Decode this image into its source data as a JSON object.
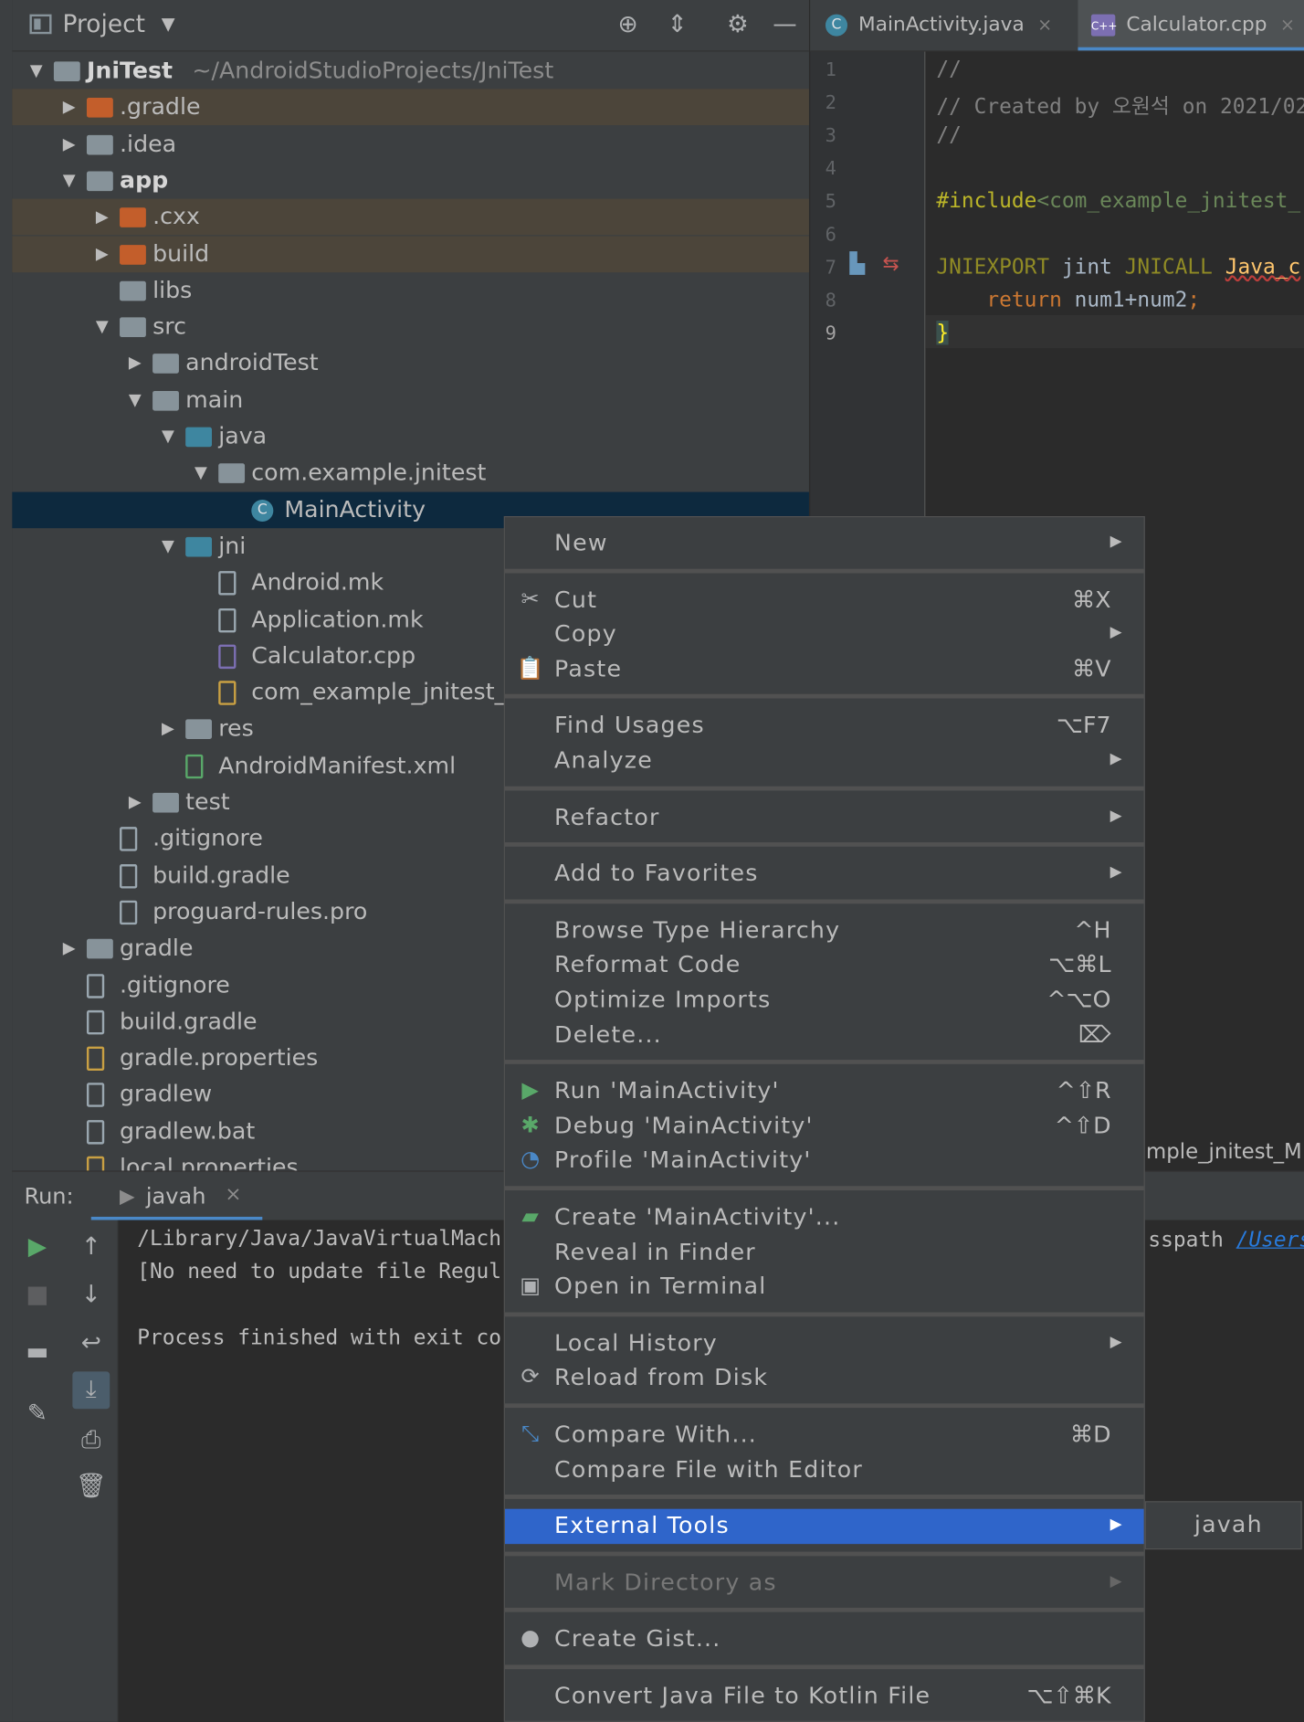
{
  "project_panel": {
    "title": "Project",
    "tree": [
      {
        "label": "JniTest",
        "hint": "~/AndroidStudioProjects/JniTest",
        "depth": 0,
        "arrow": "▼",
        "icon": "module-folder-icon",
        "bold": true
      },
      {
        "label": ".gradle",
        "depth": 1,
        "arrow": "▶",
        "icon": "folder-excluded-icon",
        "excluded": true
      },
      {
        "label": ".idea",
        "depth": 1,
        "arrow": "▶",
        "icon": "folder-icon"
      },
      {
        "label": "app",
        "depth": 1,
        "arrow": "▼",
        "icon": "module-folder-icon",
        "bold": true
      },
      {
        "label": ".cxx",
        "depth": 2,
        "arrow": "▶",
        "icon": "folder-excluded-icon",
        "excluded": true
      },
      {
        "label": "build",
        "depth": 2,
        "arrow": "▶",
        "icon": "folder-excluded-icon",
        "excluded": true
      },
      {
        "label": "libs",
        "depth": 2,
        "arrow": "",
        "icon": "folder-icon"
      },
      {
        "label": "src",
        "depth": 2,
        "arrow": "▼",
        "icon": "folder-icon"
      },
      {
        "label": "androidTest",
        "depth": 3,
        "arrow": "▶",
        "icon": "folder-icon"
      },
      {
        "label": "main",
        "depth": 3,
        "arrow": "▼",
        "icon": "folder-icon"
      },
      {
        "label": "java",
        "depth": 4,
        "arrow": "▼",
        "icon": "source-folder-icon"
      },
      {
        "label": "com.example.jnitest",
        "depth": 5,
        "arrow": "▼",
        "icon": "package-icon"
      },
      {
        "label": "MainActivity",
        "depth": 6,
        "arrow": "",
        "icon": "class-icon",
        "selected": true
      },
      {
        "label": "jni",
        "depth": 4,
        "arrow": "▼",
        "icon": "source-folder-icon"
      },
      {
        "label": "Android.mk",
        "depth": 5,
        "arrow": "",
        "icon": "file-icon"
      },
      {
        "label": "Application.mk",
        "depth": 5,
        "arrow": "",
        "icon": "file-icon"
      },
      {
        "label": "Calculator.cpp",
        "depth": 5,
        "arrow": "",
        "icon": "cpp-file-icon"
      },
      {
        "label": "com_example_jnitest_",
        "depth": 5,
        "arrow": "",
        "icon": "header-file-icon"
      },
      {
        "label": "res",
        "depth": 4,
        "arrow": "▶",
        "icon": "resources-folder-icon"
      },
      {
        "label": "AndroidManifest.xml",
        "depth": 4,
        "arrow": "",
        "icon": "manifest-file-icon"
      },
      {
        "label": "test",
        "depth": 3,
        "arrow": "▶",
        "icon": "folder-icon"
      },
      {
        "label": ".gitignore",
        "depth": 2,
        "arrow": "",
        "icon": "gitignore-icon"
      },
      {
        "label": "build.gradle",
        "depth": 2,
        "arrow": "",
        "icon": "gradle-elephant-icon"
      },
      {
        "label": "proguard-rules.pro",
        "depth": 2,
        "arrow": "",
        "icon": "file-icon"
      },
      {
        "label": "gradle",
        "depth": 1,
        "arrow": "▶",
        "icon": "folder-icon"
      },
      {
        "label": ".gitignore",
        "depth": 1,
        "arrow": "",
        "icon": "gitignore-icon"
      },
      {
        "label": "build.gradle",
        "depth": 1,
        "arrow": "",
        "icon": "gradle-elephant-icon"
      },
      {
        "label": "gradle.properties",
        "depth": 1,
        "arrow": "",
        "icon": "properties-file-icon"
      },
      {
        "label": "gradlew",
        "depth": 1,
        "arrow": "",
        "icon": "shell-script-icon"
      },
      {
        "label": "gradlew.bat",
        "depth": 1,
        "arrow": "",
        "icon": "file-icon"
      },
      {
        "label": "local.properties",
        "depth": 1,
        "arrow": "",
        "icon": "properties-file-icon"
      }
    ]
  },
  "editor_tabs": [
    {
      "label": "MainActivity.java",
      "icon": "java-class-icon",
      "close": "×",
      "active": false
    },
    {
      "label": "Calculator.cpp",
      "icon": "cpp-file-icon",
      "close": "×",
      "active": true
    }
  ],
  "editor": {
    "line_numbers": [
      "1",
      "2",
      "3",
      "4",
      "5",
      "6",
      "7",
      "8",
      "9"
    ],
    "lines": [
      [
        {
          "t": "//",
          "c": "c-com"
        }
      ],
      [
        {
          "t": "// Created by 오원석 on 2021/02",
          "c": "c-com"
        }
      ],
      [
        {
          "t": "//",
          "c": "c-com"
        }
      ],
      [],
      [
        {
          "t": "#include",
          "c": "c-pre"
        },
        {
          "t": "<com_example_jnitest_",
          "c": "c-str"
        }
      ],
      [],
      [
        {
          "t": "JNIEXPORT",
          "c": "c-mac"
        },
        {
          "t": " jint ",
          "c": "c-plain"
        },
        {
          "t": "JNICALL",
          "c": "c-mac"
        },
        {
          "t": " ",
          "c": "c-plain"
        },
        {
          "t": "Java_c",
          "c": "c-fn"
        }
      ],
      [
        {
          "t": "    return",
          "c": "c-kw"
        },
        {
          "t": " num1+num2",
          "c": "c-plain"
        },
        {
          "t": ";",
          "c": "c-kw"
        }
      ],
      [
        {
          "t": "}",
          "c": "c-brace"
        }
      ]
    ],
    "current_line": "9"
  },
  "run_panel": {
    "label": "Run:",
    "tab_label": "javah",
    "tab_close": "×",
    "console_lines": [
      "/Library/Java/JavaVirtualMach",
      "[No need to update file Regul",
      "",
      "Process finished with exit co"
    ],
    "right_fragment": "sspath ",
    "right_link": "/Users"
  },
  "editor_status_fragment": "mple_jnitest_M",
  "context_menu": {
    "items": [
      {
        "label": "New",
        "submenu": true
      },
      {
        "sep": true
      },
      {
        "label": "Cut",
        "shortcut": "⌘X",
        "icon": "scissors-icon",
        "glyph": "✂"
      },
      {
        "label": "Copy",
        "submenu": true
      },
      {
        "label": "Paste",
        "shortcut": "⌘V",
        "icon": "clipboard-icon",
        "glyph": "📋"
      },
      {
        "sep": true
      },
      {
        "label": "Find Usages",
        "shortcut": "⌥F7"
      },
      {
        "label": "Analyze",
        "submenu": true
      },
      {
        "sep": true
      },
      {
        "label": "Refactor",
        "submenu": true
      },
      {
        "sep": true
      },
      {
        "label": "Add to Favorites",
        "submenu": true
      },
      {
        "sep": true
      },
      {
        "label": "Browse Type Hierarchy",
        "shortcut": "^H"
      },
      {
        "label": "Reformat Code",
        "shortcut": "⌥⌘L"
      },
      {
        "label": "Optimize Imports",
        "shortcut": "^⌥O"
      },
      {
        "label": "Delete...",
        "shortcut": "⌦"
      },
      {
        "sep": true
      },
      {
        "label": "Run 'MainActivity'",
        "shortcut": "^⇧R",
        "icon": "run-icon",
        "glyph": "▶",
        "color": "green"
      },
      {
        "label": "Debug 'MainActivity'",
        "shortcut": "^⇧D",
        "icon": "debug-bug-icon",
        "glyph": "✱",
        "color": "green"
      },
      {
        "label": "Profile 'MainActivity'",
        "icon": "profiler-gauge-icon",
        "glyph": "◔",
        "color": "blue"
      },
      {
        "sep": true
      },
      {
        "label": "Create 'MainActivity'...",
        "icon": "android-icon",
        "glyph": "▰",
        "color": "green"
      },
      {
        "label": "Reveal in Finder"
      },
      {
        "label": "Open in Terminal",
        "icon": "terminal-icon",
        "glyph": "▣"
      },
      {
        "sep": true
      },
      {
        "label": "Local History",
        "submenu": true
      },
      {
        "label": "Reload from Disk",
        "icon": "reload-icon",
        "glyph": "⟳"
      },
      {
        "sep": true
      },
      {
        "label": "Compare With...",
        "shortcut": "⌘D",
        "icon": "compare-icon",
        "glyph": "⤡",
        "color": "blue"
      },
      {
        "label": "Compare File with Editor"
      },
      {
        "sep": true
      },
      {
        "label": "External Tools",
        "submenu": true,
        "highlight": true
      },
      {
        "sep": true
      },
      {
        "label": "Mark Directory as",
        "submenu": true,
        "disabled": true
      },
      {
        "sep": true
      },
      {
        "label": "Create Gist...",
        "icon": "github-icon",
        "glyph": "●"
      },
      {
        "sep": true
      },
      {
        "label": "Convert Java File to Kotlin File",
        "shortcut": "⌥⇧⌘K"
      }
    ],
    "submenu_item": "javah"
  }
}
